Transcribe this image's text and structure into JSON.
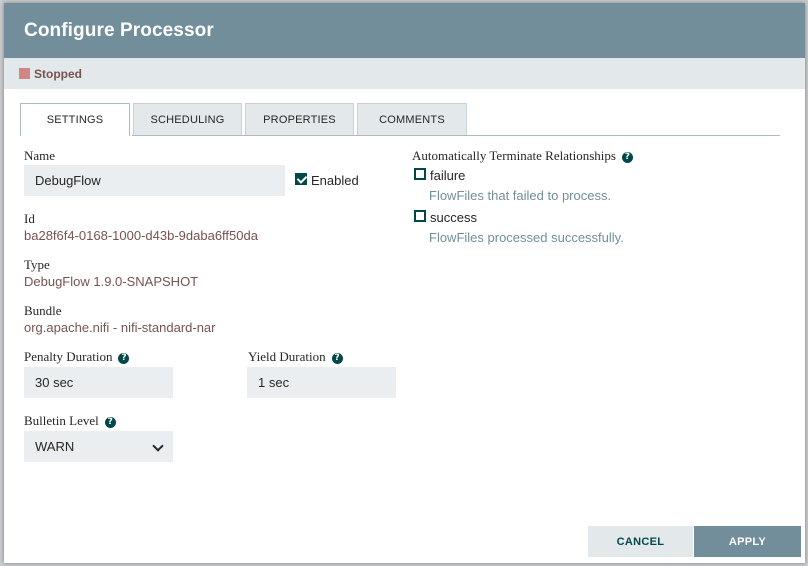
{
  "dialog": {
    "title": "Configure Processor",
    "status": "Stopped"
  },
  "tabs": [
    {
      "label": "SETTINGS",
      "active": true
    },
    {
      "label": "SCHEDULING",
      "active": false
    },
    {
      "label": "PROPERTIES",
      "active": false
    },
    {
      "label": "COMMENTS",
      "active": false
    }
  ],
  "settings": {
    "name_label": "Name",
    "name_value": "DebugFlow",
    "enabled_label": "Enabled",
    "enabled": true,
    "id_label": "Id",
    "id_value": "ba28f6f4-0168-1000-d43b-9daba6ff50da",
    "type_label": "Type",
    "type_value": "DebugFlow 1.9.0-SNAPSHOT",
    "bundle_label": "Bundle",
    "bundle_value": "org.apache.nifi - nifi-standard-nar",
    "penalty_label": "Penalty Duration",
    "penalty_value": "30 sec",
    "yield_label": "Yield Duration",
    "yield_value": "1 sec",
    "bulletin_label": "Bulletin Level",
    "bulletin_value": "WARN"
  },
  "relationships": {
    "title": "Automatically Terminate Relationships",
    "items": [
      {
        "name": "failure",
        "description": "FlowFiles that failed to process.",
        "checked": false
      },
      {
        "name": "success",
        "description": "FlowFiles processed successfully.",
        "checked": false
      }
    ]
  },
  "buttons": {
    "cancel": "CANCEL",
    "apply": "APPLY"
  },
  "colors": {
    "header": "#728e9b",
    "accent": "#004849",
    "stopped": "#d18686"
  },
  "icons": {
    "help": "question-circle-icon",
    "checkbox": "checkbox-icon",
    "dropdown": "chevron-down-icon",
    "status": "stopped-square-icon"
  }
}
